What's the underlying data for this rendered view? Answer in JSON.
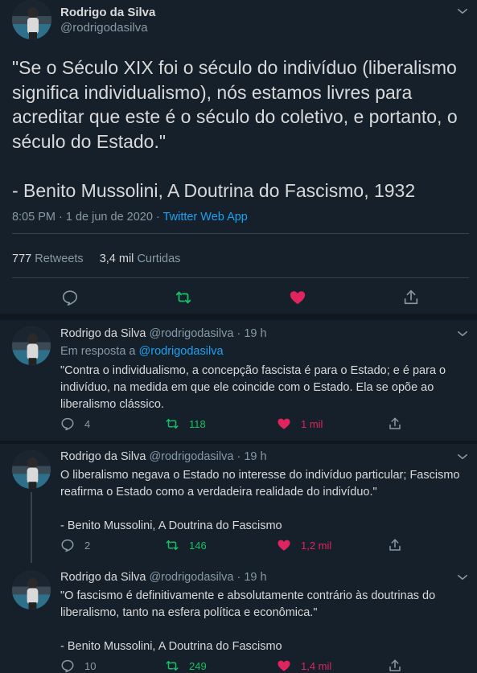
{
  "main": {
    "author": "Rodrigo da Silva",
    "handle": "@rodrigodasilva",
    "text": "\"Se o Século XIX foi o século do indivíduo (liberalismo significa individualismo), nós estamos livres para acreditar que este é o século do coletivo, e portanto, o século do Estado.\"\n\n- Benito Mussolini, A Doutrina do Fascismo, 1932",
    "time": "8:05 PM · 1 de jun de 2020 · ",
    "source": "Twitter Web App",
    "retweets_count": "777",
    "retweets_label": "Retweets",
    "likes_count": "3,4 mil",
    "likes_label": "Curtidas"
  },
  "replies": [
    {
      "author": "Rodrigo da Silva",
      "handle": "@rodrigodasilva",
      "time": "· 19 h",
      "reply_prefix": "Em resposta a ",
      "reply_to": "@rodrigodasilva",
      "text": "\"Contra o individualismo, a concepção fascista é para o Estado; e é para o indivíduo, na medida em que ele coincide com o Estado. Ela se opõe ao liberalismo clássico.",
      "replies": "4",
      "retweets": "118",
      "likes": "1 mil"
    },
    {
      "author": "Rodrigo da Silva",
      "handle": "@rodrigodasilva",
      "time": "· 19 h",
      "text": "O liberalismo negava o Estado no interesse do indivíduo particular; Fascismo reafirma o Estado como a verdadeira realidade do indivíduo.\"\n\n- Benito Mussolini, A Doutrina do Fascismo",
      "replies": "2",
      "retweets": "146",
      "likes": "1,2 mil"
    },
    {
      "author": "Rodrigo da Silva",
      "handle": "@rodrigodasilva",
      "time": "· 19 h",
      "text": "\"O fascismo é definitivamente e absolutamente contrário às doutrinas do liberalismo, tanto na esfera política e econômica.\"\n\n- Benito Mussolini, A Doutrina do Fascismo",
      "replies": "10",
      "retweets": "249",
      "likes": "1,4 mil"
    }
  ],
  "icons": {
    "reply": "reply-icon",
    "retweet": "retweet-icon",
    "like": "heart-icon",
    "share": "share-icon",
    "menu": "chevron-down-icon"
  },
  "colors": {
    "background": "#15202b",
    "accent": "#1da1f2",
    "retweet": "#17bf63",
    "like": "#e0245e",
    "muted": "#8899a6",
    "text": "#d9d9d9"
  }
}
